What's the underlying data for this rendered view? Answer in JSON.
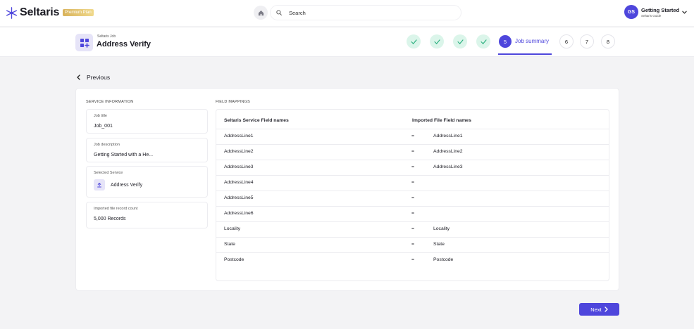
{
  "app": {
    "name": "Seltaris",
    "plan_badge": "Premium Plan"
  },
  "search": {
    "placeholder": "Search",
    "value": ""
  },
  "user": {
    "initials": "GS",
    "name": "Getting Started",
    "subtitle": "Seltaris Guide"
  },
  "job": {
    "label": "Seltaris Job",
    "title": "Address Verify"
  },
  "steps": [
    {
      "number": "1",
      "state": "complete"
    },
    {
      "number": "2",
      "state": "complete"
    },
    {
      "number": "3",
      "state": "complete"
    },
    {
      "number": "4",
      "state": "complete"
    },
    {
      "number": "5",
      "state": "current",
      "label": "Job summary"
    },
    {
      "number": "6",
      "state": "pending"
    },
    {
      "number": "7",
      "state": "pending"
    },
    {
      "number": "8",
      "state": "pending"
    }
  ],
  "nav": {
    "previous_label": "Previous",
    "next_label": "Next"
  },
  "service_info": {
    "title": "SERVICE INFORMATION",
    "job_title_label": "Job title",
    "job_title_value": "Job_001",
    "job_description_label": "Job description",
    "job_description_value": "Getting Started with a He...",
    "selected_service_label": "Selected Service",
    "selected_service_value": "Address Verify",
    "record_count_label": "Imported file record count",
    "record_count_value": "5,000 Records"
  },
  "field_mappings": {
    "title": "FIELD MAPPINGS",
    "col_service": "Seltaris Service Field names",
    "col_imported": "Imported File Field names",
    "rows": [
      {
        "service": "AddressLine1",
        "sep": "=",
        "imported": "AddressLine1"
      },
      {
        "service": "AddressLine2",
        "sep": "=",
        "imported": "AddressLine2"
      },
      {
        "service": "AddressLine3",
        "sep": "=",
        "imported": "AddressLine3"
      },
      {
        "service": "AddressLine4",
        "sep": "=",
        "imported": ""
      },
      {
        "service": "AddressLine5",
        "sep": "=",
        "imported": ""
      },
      {
        "service": "AddressLine6",
        "sep": "=",
        "imported": ""
      },
      {
        "service": "Locality",
        "sep": "=",
        "imported": "Locality"
      },
      {
        "service": "State",
        "sep": "=",
        "imported": "State"
      },
      {
        "service": "Postcode",
        "sep": "=",
        "imported": "Postcode"
      }
    ]
  },
  "colors": {
    "accent": "#4e46dc",
    "step_complete_bg": "#dbf5ea",
    "step_complete_check": "#2bb07f"
  }
}
